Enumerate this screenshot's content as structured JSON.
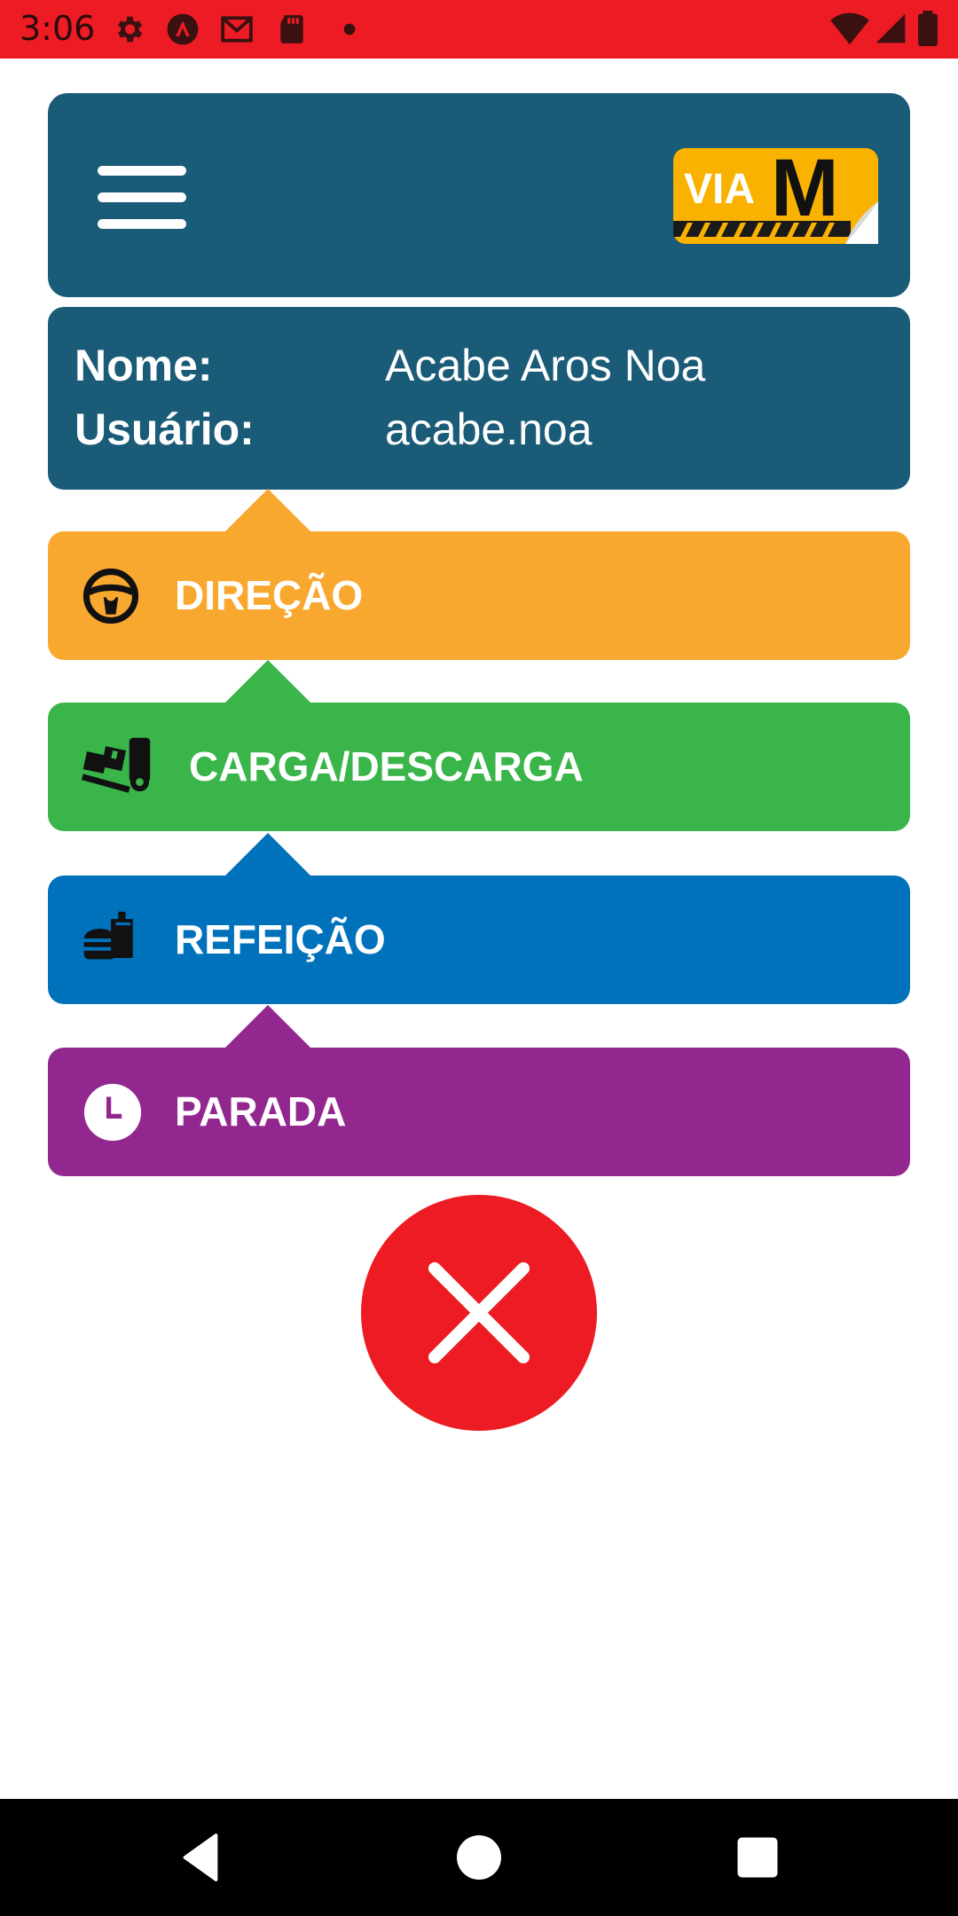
{
  "status_bar": {
    "time": "3:06",
    "left_icons": [
      "gear-icon",
      "brand-a-icon",
      "gmail-icon",
      "sd-card-icon",
      "dot-icon"
    ],
    "right_icons": [
      "wifi-icon",
      "signal-icon",
      "battery-icon"
    ],
    "color": "#ed1c24"
  },
  "header": {
    "menu_icon": "hamburger-menu-icon",
    "logo": {
      "text_left": "VIA",
      "text_right": "M"
    },
    "color": "#1a5b78"
  },
  "user_info": {
    "name_label": "Nome:",
    "name_value": "Acabe Aros Noa",
    "user_label": "Usuário:",
    "user_value": "acabe.noa"
  },
  "actions": [
    {
      "label": "DIREÇÃO",
      "icon": "steering-wheel-icon",
      "color": "#f9a82f"
    },
    {
      "label": "CARGA/DESCARGA",
      "icon": "forklift-icon",
      "color": "#3ab54a"
    },
    {
      "label": "REFEIÇÃO",
      "icon": "fastfood-icon",
      "color": "#0072bc"
    },
    {
      "label": "PARADA",
      "icon": "clock-icon",
      "color": "#92278f"
    }
  ],
  "close_button": {
    "icon": "close-icon",
    "color": "#ed1c24"
  },
  "nav_bar": {
    "back": "back-icon",
    "home": "home-icon",
    "recents": "recents-icon"
  }
}
